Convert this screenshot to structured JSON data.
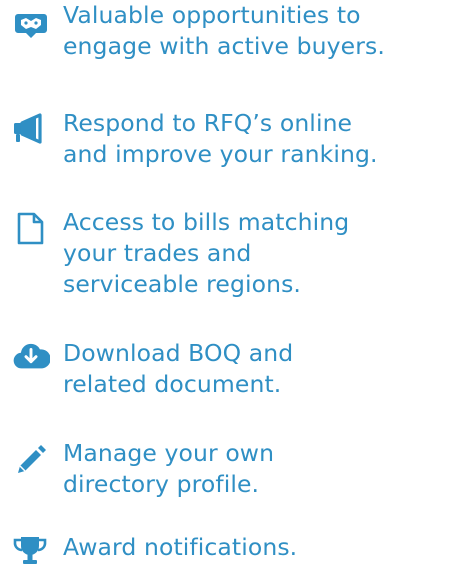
{
  "brand_color": "#2f8fc4",
  "benefits": [
    {
      "icon": "chat-handshake-icon",
      "text": "Valuable opportunities to\nengage with active buyers."
    },
    {
      "icon": "megaphone-icon",
      "text": "Respond to RFQ’s online\nand improve your ranking."
    },
    {
      "icon": "document-icon",
      "text": "Access to bills matching\nyour trades and\nserviceable regions."
    },
    {
      "icon": "cloud-download-icon",
      "text": "Download BOQ and\nrelated document."
    },
    {
      "icon": "pencil-icon",
      "text": "Manage your own\ndirectory profile."
    },
    {
      "icon": "trophy-icon",
      "text": "Award notifications."
    }
  ]
}
